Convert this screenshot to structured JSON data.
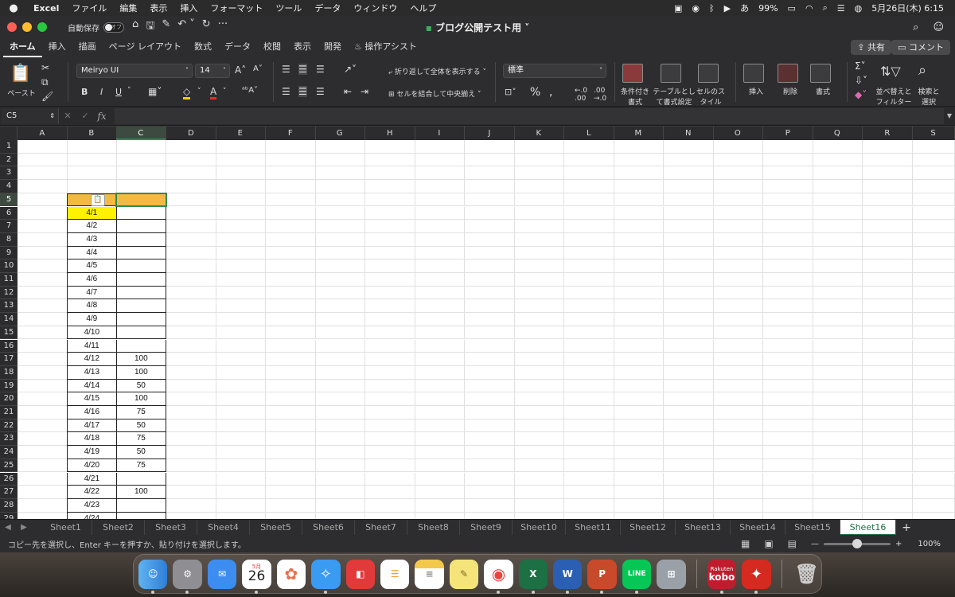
{
  "menubar": {
    "items": [
      "Excel",
      "ファイル",
      "編集",
      "表示",
      "挿入",
      "フォーマット",
      "ツール",
      "データ",
      "ウィンドウ",
      "ヘルプ"
    ],
    "battery": "99%",
    "ime": "あ",
    "datetime": "5月26日(木)  6:15"
  },
  "titlebar": {
    "autosave_label": "自動保存",
    "autosave_state": "オフ",
    "doc_title": "ブログ公開テスト用"
  },
  "ribbon_tabs": {
    "items": [
      "ホーム",
      "挿入",
      "描画",
      "ページ レイアウト",
      "数式",
      "データ",
      "校閲",
      "表示",
      "開発"
    ],
    "assist": "操作アシスト",
    "share": "共有",
    "comment": "コメント"
  },
  "ribbon": {
    "paste": "ペースト",
    "font_name": "Meiryo UI",
    "font_size": "14",
    "bold": "B",
    "italic": "I",
    "underline": "U",
    "wrap_text": "折り返して全体を表示する",
    "merge_center": "セルを結合して中央揃え",
    "number_format": "標準",
    "cond_format": "条件付き書式",
    "table_format": "テーブルとして書式設定",
    "cell_style": "セルのスタイル",
    "insert": "挿入",
    "delete": "削除",
    "format": "書式",
    "sort_filter": "並べ替えとフィルター",
    "find_select": "検索と選択"
  },
  "formula_bar": {
    "name_box": "C5",
    "fx": "fx",
    "formula": ""
  },
  "grid": {
    "columns": [
      "A",
      "B",
      "C",
      "D",
      "E",
      "F",
      "G",
      "H",
      "I",
      "J",
      "K",
      "L",
      "M",
      "N",
      "O",
      "P",
      "Q",
      "R",
      "S"
    ],
    "selected_column": "C",
    "selected_row": "5",
    "rows": [
      "1",
      "2",
      "3",
      "4",
      "5",
      "6",
      "7",
      "8",
      "9",
      "10",
      "11",
      "12",
      "13",
      "14",
      "15",
      "16",
      "17",
      "18",
      "19",
      "20",
      "21",
      "22",
      "23",
      "24",
      "25",
      "26",
      "27",
      "28",
      "29"
    ],
    "table": [
      {
        "row": "6",
        "b": "4/1",
        "c": ""
      },
      {
        "row": "7",
        "b": "4/2",
        "c": ""
      },
      {
        "row": "8",
        "b": "4/3",
        "c": ""
      },
      {
        "row": "9",
        "b": "4/4",
        "c": ""
      },
      {
        "row": "10",
        "b": "4/5",
        "c": ""
      },
      {
        "row": "11",
        "b": "4/6",
        "c": ""
      },
      {
        "row": "12",
        "b": "4/7",
        "c": ""
      },
      {
        "row": "13",
        "b": "4/8",
        "c": ""
      },
      {
        "row": "14",
        "b": "4/9",
        "c": ""
      },
      {
        "row": "15",
        "b": "4/10",
        "c": ""
      },
      {
        "row": "16",
        "b": "4/11",
        "c": ""
      },
      {
        "row": "17",
        "b": "4/12",
        "c": "100"
      },
      {
        "row": "18",
        "b": "4/13",
        "c": "100"
      },
      {
        "row": "19",
        "b": "4/14",
        "c": "50"
      },
      {
        "row": "20",
        "b": "4/15",
        "c": "100"
      },
      {
        "row": "21",
        "b": "4/16",
        "c": "75"
      },
      {
        "row": "22",
        "b": "4/17",
        "c": "50"
      },
      {
        "row": "23",
        "b": "4/18",
        "c": "75"
      },
      {
        "row": "24",
        "b": "4/19",
        "c": "50"
      },
      {
        "row": "25",
        "b": "4/20",
        "c": "75"
      },
      {
        "row": "26",
        "b": "4/21",
        "c": ""
      },
      {
        "row": "27",
        "b": "4/22",
        "c": "100"
      },
      {
        "row": "28",
        "b": "4/23",
        "c": ""
      },
      {
        "row": "29",
        "b": "4/24",
        "c": ""
      }
    ],
    "colors": {
      "header_fill": "#f4b942",
      "highlight_fill": "#fff200",
      "selection": "#2e8b57"
    }
  },
  "sheets": {
    "tabs": [
      "Sheet1",
      "Sheet2",
      "Sheet3",
      "Sheet4",
      "Sheet5",
      "Sheet6",
      "Sheet7",
      "Sheet8",
      "Sheet9",
      "Sheet10",
      "Sheet11",
      "Sheet12",
      "Sheet13",
      "Sheet14",
      "Sheet15",
      "Sheet16"
    ],
    "active": "Sheet16",
    "add": "+"
  },
  "status": {
    "message": "コピー先を選択し、Enter キーを押すか、貼り付けを選択します。",
    "zoom": "100%",
    "zoom_level": 0.5
  },
  "dock": {
    "calendar_month": "5月",
    "calendar_day": "26",
    "kobo_top": "Rakuten",
    "kobo_bottom": "kobo",
    "icons": [
      "finder-icon",
      "settings-icon",
      "mail-icon",
      "calendar-icon",
      "photos-icon",
      "safari-icon",
      "photo-booth-icon",
      "reminders-icon",
      "notes-icon",
      "stickies-icon",
      "chrome-icon",
      "excel-icon",
      "word-icon",
      "powerpoint-icon",
      "line-icon",
      "launchpad-icon",
      "kobo-icon",
      "acrobat-icon",
      "trash-icon"
    ]
  }
}
